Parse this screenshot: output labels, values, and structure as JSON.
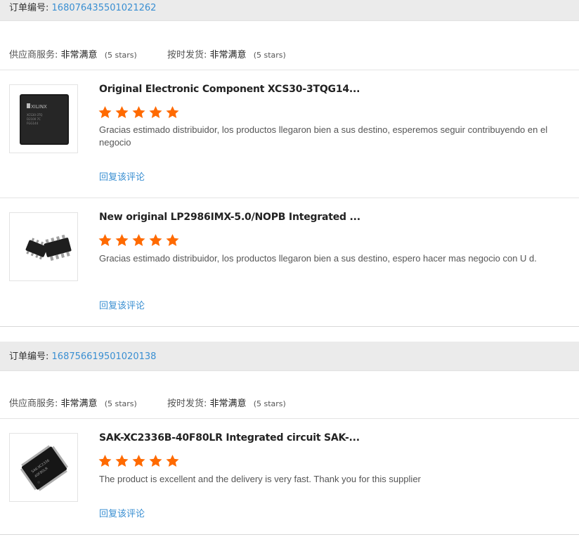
{
  "orders": [
    {
      "order_label": "订单编号:",
      "order_id": "168076435501021262",
      "supplier_service_label": "供应商服务:",
      "supplier_service_value": "非常满意",
      "supplier_service_stars": "(5 stars)",
      "delivery_label": "按时发货:",
      "delivery_value": "非常满意",
      "delivery_stars": "(5 stars)",
      "items": [
        {
          "title": "Original Electronic Component XCS30-3TQG14...",
          "rating": 5,
          "comment": "Gracias estimado distribuidor, los productos llegaron bien a sus destino, esperemos seguir contribuyendo en el negocio",
          "reply_label": "回复该评论",
          "thumb_icon": "qfp-chip-image"
        },
        {
          "title": "New original LP2986IMX-5.0/NOPB Integrated ...",
          "rating": 5,
          "comment": "Gracias estimado distribuidor, los productos llegaron bien a sus destino, espero hacer mas negocio con U d.",
          "reply_label": "回复该评论",
          "thumb_icon": "soic-chip-image"
        }
      ]
    },
    {
      "order_label": "订单编号:",
      "order_id": "168756619501020138",
      "supplier_service_label": "供应商服务:",
      "supplier_service_value": "非常满意",
      "supplier_service_stars": "(5 stars)",
      "delivery_label": "按时发货:",
      "delivery_value": "非常满意",
      "delivery_stars": "(5 stars)",
      "items": [
        {
          "title": "SAK-XC2336B-40F80LR Integrated circuit SAK-...",
          "rating": 5,
          "comment": "The product is excellent and the delivery is very fast. Thank you for this supplier",
          "reply_label": "回复该评论",
          "thumb_icon": "lqfp-chip-image"
        }
      ]
    }
  ],
  "colors": {
    "accent": "#3a8fd2",
    "star": "#ff6a00",
    "header_bg": "#ebebeb"
  }
}
